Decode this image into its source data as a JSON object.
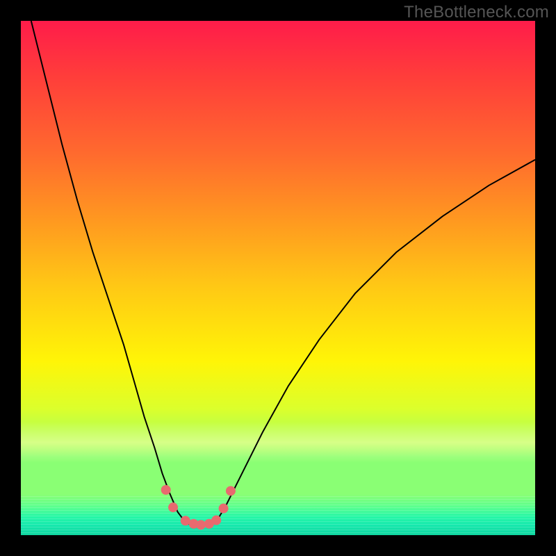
{
  "watermark": "TheBottleneck.com",
  "chart_data": {
    "type": "line",
    "title": "",
    "xlabel": "",
    "ylabel": "",
    "xlim": [
      0,
      100
    ],
    "ylim": [
      0,
      100
    ],
    "background_gradient": {
      "top_color": "#ff1c4a",
      "mid_color": "#fff507",
      "bottom_color": "#17e9ad",
      "description": "smooth vertical rainbow gradient from red (top) through orange, yellow, light green to teal-green (bottom); a pale yellow band near y≈20 and fine green striations in the lowest 8%"
    },
    "series": [
      {
        "name": "left-branch",
        "x": [
          2,
          5,
          8,
          11,
          14,
          17,
          20,
          22,
          24,
          26,
          27.5,
          29,
          30.5,
          32
        ],
        "y": [
          100,
          88,
          76,
          65,
          55,
          46,
          37,
          30,
          23,
          17,
          12,
          8,
          4.5,
          2.5
        ]
      },
      {
        "name": "valley",
        "x": [
          32,
          33,
          34,
          35,
          36,
          37,
          38
        ],
        "y": [
          2.5,
          2,
          1.8,
          1.8,
          1.9,
          2.1,
          2.6
        ]
      },
      {
        "name": "right-branch",
        "x": [
          38,
          40,
          43,
          47,
          52,
          58,
          65,
          73,
          82,
          91,
          100
        ],
        "y": [
          2.6,
          6,
          12,
          20,
          29,
          38,
          47,
          55,
          62,
          68,
          73
        ]
      }
    ],
    "markers": {
      "name": "valley-dots",
      "color": "#e86a6f",
      "radius": 7,
      "points": [
        {
          "x": 28.2,
          "y": 8.8
        },
        {
          "x": 29.6,
          "y": 5.4
        },
        {
          "x": 32.0,
          "y": 2.8
        },
        {
          "x": 33.6,
          "y": 2.2
        },
        {
          "x": 35.0,
          "y": 2.0
        },
        {
          "x": 36.6,
          "y": 2.2
        },
        {
          "x": 38.0,
          "y": 2.9
        },
        {
          "x": 39.4,
          "y": 5.2
        },
        {
          "x": 40.8,
          "y": 8.6
        }
      ]
    }
  }
}
